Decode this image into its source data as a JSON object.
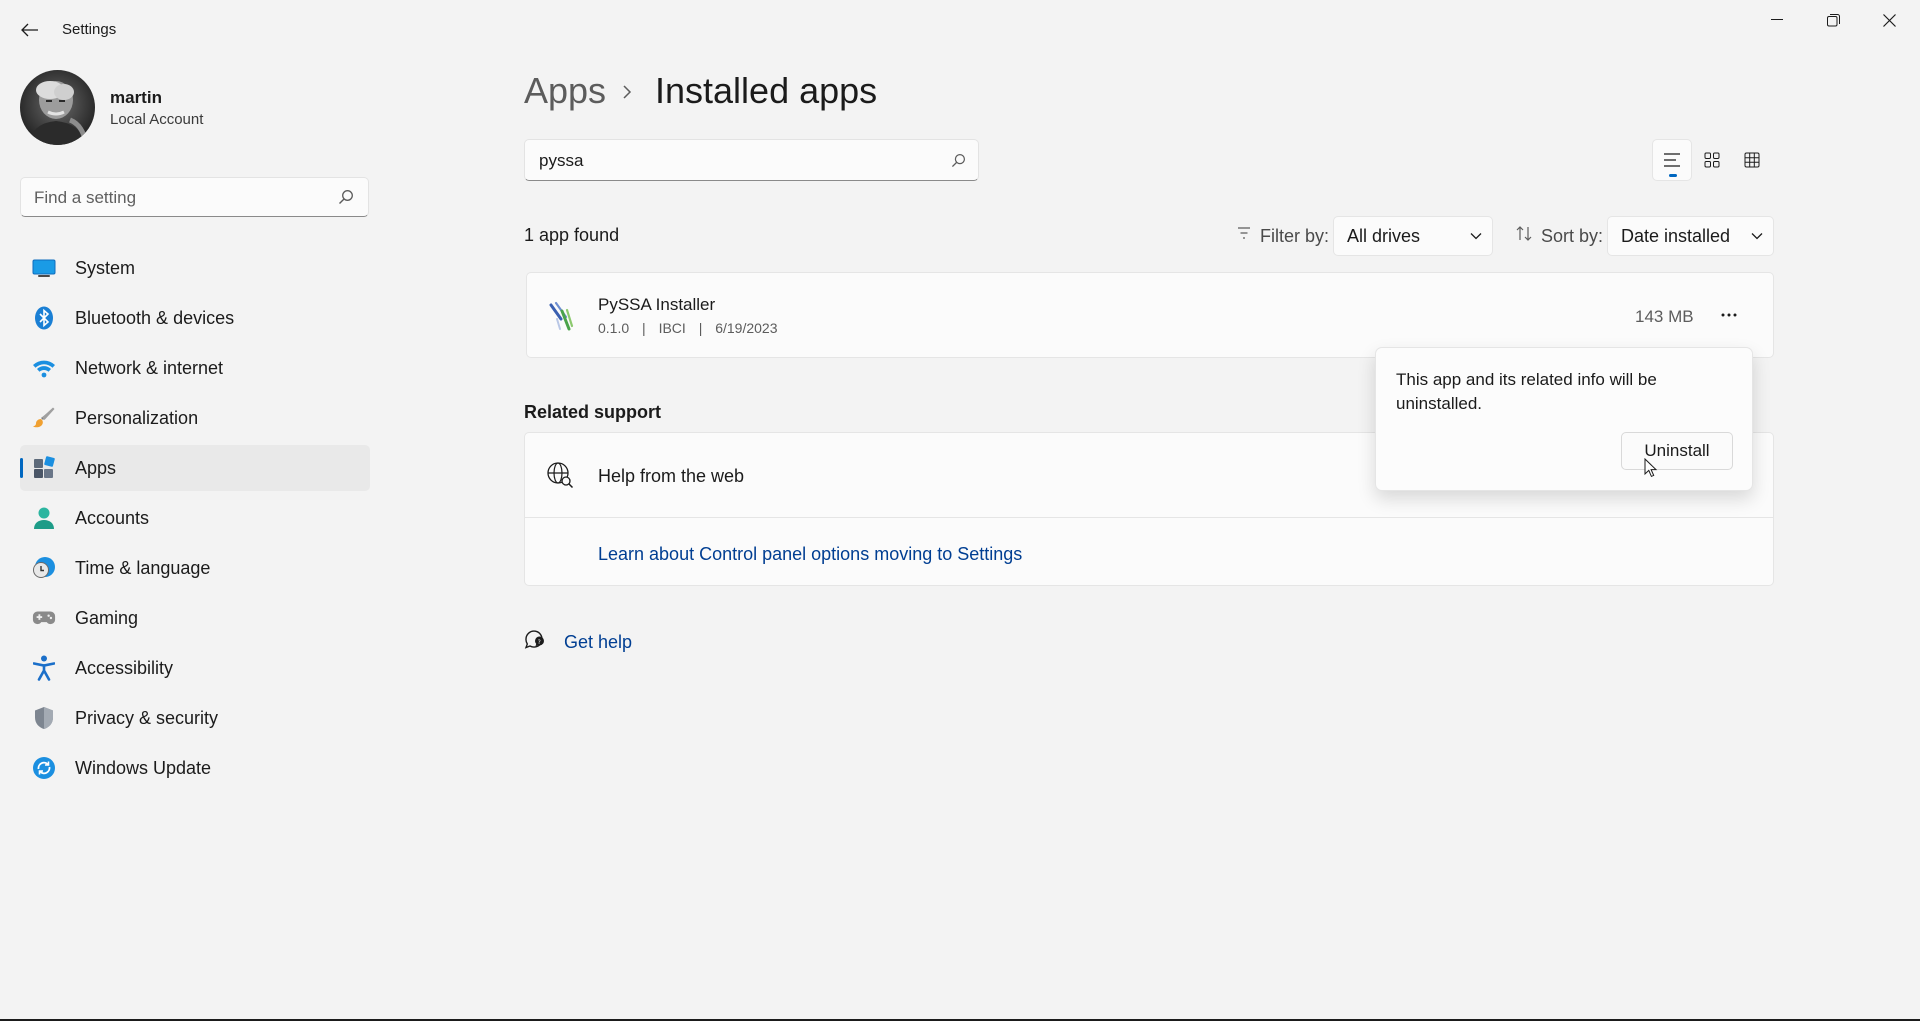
{
  "window": {
    "title": "Settings"
  },
  "profile": {
    "name": "martin",
    "account_type": "Local Account"
  },
  "sidebar": {
    "search_placeholder": "Find a setting",
    "items": [
      {
        "label": "System",
        "icon": "system-icon"
      },
      {
        "label": "Bluetooth & devices",
        "icon": "bluetooth-icon"
      },
      {
        "label": "Network & internet",
        "icon": "wifi-icon"
      },
      {
        "label": "Personalization",
        "icon": "brush-icon"
      },
      {
        "label": "Apps",
        "icon": "apps-icon",
        "active": true
      },
      {
        "label": "Accounts",
        "icon": "person-icon"
      },
      {
        "label": "Time & language",
        "icon": "clock-globe-icon"
      },
      {
        "label": "Gaming",
        "icon": "gamepad-icon"
      },
      {
        "label": "Accessibility",
        "icon": "accessibility-icon"
      },
      {
        "label": "Privacy & security",
        "icon": "shield-icon"
      },
      {
        "label": "Windows Update",
        "icon": "update-icon"
      }
    ]
  },
  "breadcrumb": {
    "parent": "Apps",
    "current": "Installed apps"
  },
  "app_search": {
    "value": "pyssa"
  },
  "results": {
    "count_text": "1 app found",
    "filter_label": "Filter by:",
    "filter_value": "All drives",
    "sort_label": "Sort by:",
    "sort_value": "Date installed"
  },
  "apps": [
    {
      "name": "PySSA Installer",
      "version": "0.1.0",
      "publisher": "IBCI",
      "date": "6/19/2023",
      "separator": "|",
      "size": "143 MB"
    }
  ],
  "related_support": {
    "title": "Related support",
    "help_label": "Help from the web",
    "link": "Learn about Control panel options moving to Settings"
  },
  "get_help": "Get help",
  "flyout": {
    "message": "This app and its related info will be uninstalled.",
    "button": "Uninstall"
  },
  "colors": {
    "accent": "#0067c0",
    "link": "#003e92",
    "background": "#f3f3f3"
  }
}
